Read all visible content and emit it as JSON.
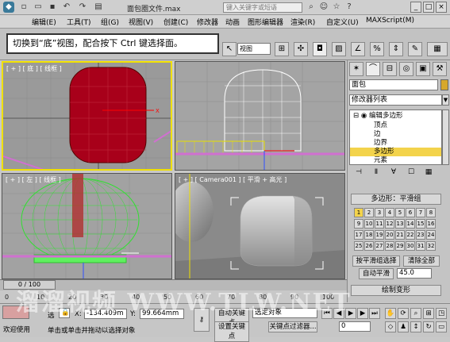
{
  "title": {
    "doc_name": "面包圈文件.max",
    "search_placeholder": "键入关键字或短语",
    "logo_icon": "3dsmax-logo-icon"
  },
  "menu": [
    "编辑(E)",
    "工具(T)",
    "组(G)",
    "视图(V)",
    "创建(C)",
    "修改器",
    "动画",
    "图形编辑器",
    "渲染(R)",
    "自定义(U)",
    "MAXScript(M)"
  ],
  "toolbar": {
    "view_dropdown": "视图"
  },
  "tooltip": {
    "text": "切换到“底”视图，配合按下 Ctrl 键选择面。"
  },
  "viewports": {
    "top_left": "[ + ] [ 底 ] [ 线框 ]",
    "top_right": "",
    "bottom_left": "[ + ] [ 左 ] [ 线框 ]",
    "bottom_right": "[ + ] [ Camera001 ] [ 平滑 + 高光 ]"
  },
  "panel": {
    "object_name": "面包",
    "object_color": "#d7a82a",
    "modifier_list": "修改器列表",
    "stack": [
      {
        "label": "编辑多边形",
        "indent": 1,
        "selected": false
      },
      {
        "label": "顶点",
        "indent": 2,
        "selected": false
      },
      {
        "label": "边",
        "indent": 2,
        "selected": false
      },
      {
        "label": "边界",
        "indent": 2,
        "selected": false
      },
      {
        "label": "多边形",
        "indent": 2,
        "selected": true
      },
      {
        "label": "元素",
        "indent": 2,
        "selected": false
      }
    ],
    "rollout_title": "多边形：平滑组",
    "smoothing_groups": [
      "1",
      "2",
      "3",
      "4",
      "5",
      "6",
      "7",
      "8",
      "9",
      "10",
      "11",
      "12",
      "13",
      "14",
      "15",
      "16",
      "17",
      "18",
      "19",
      "20",
      "21",
      "22",
      "23",
      "24",
      "25",
      "26",
      "27",
      "28",
      "29",
      "30",
      "31",
      "32"
    ],
    "select_by_sg": "按平滑组选择",
    "clear_all": "清除全部",
    "auto_smooth": "自动平滑",
    "auto_smooth_value": "45.0",
    "paint_deform": "绘制变形"
  },
  "timeline": {
    "slider": "0 / 100",
    "ticks": [
      "0",
      "10",
      "20",
      "30",
      "40",
      "50",
      "60",
      "70",
      "80",
      "90",
      "100"
    ]
  },
  "status": {
    "welcome": "欢迎使用",
    "select_label": "选",
    "x_label": "X:",
    "x_value": "-134.409m",
    "y_label": "Y:",
    "y_value": "99.664mm",
    "prompt": "单击或单击并拖动以选择对象",
    "auto_key": "自动关键点",
    "set_key": "设置关键点",
    "selected_object": "选定对象",
    "key_filters": "关键点过滤器...",
    "frame_value": "0"
  },
  "watermark": "溜溜视频 WWW.TLW.NET"
}
